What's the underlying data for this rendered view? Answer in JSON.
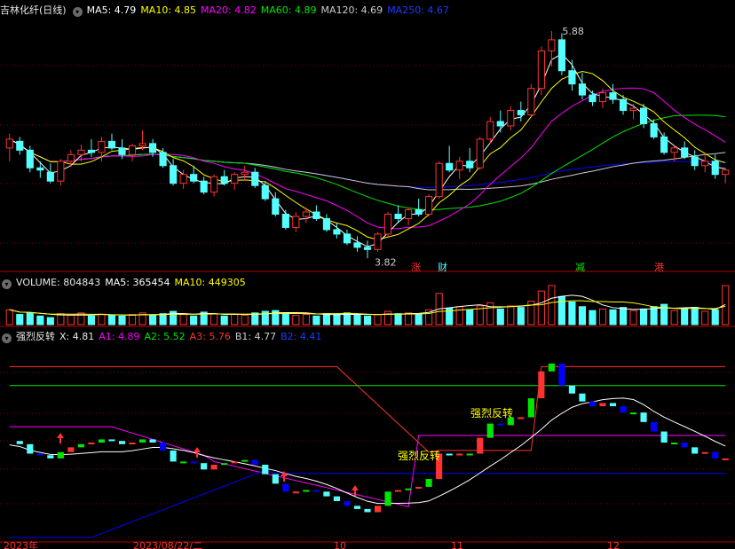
{
  "main_legend": {
    "title": "吉林化纤(日线)",
    "ma5": "MA5: 4.79",
    "ma10": "MA10: 4.85",
    "ma20": "MA20: 4.82",
    "ma60": "MA60: 4.89",
    "ma120": "MA120: 4.69",
    "ma250": "MA250: 4.67"
  },
  "volume_legend": {
    "volume": "VOLUME: 804843",
    "ma5": "MA5: 365454",
    "ma10": "MA10: 449305"
  },
  "indicator_legend": {
    "name": "强烈反转",
    "x": "X: 4.81",
    "a1": "A1: 4.89",
    "a2": "A2: 5.52",
    "a3": "A3: 5.76",
    "b1": "B1: 4.77",
    "b2": "B2: 4.41"
  },
  "colors": {
    "up": "#ff3232",
    "down": "#54ffff",
    "ma5": "#ffffff",
    "ma10": "#ffff00",
    "ma20": "#ff00ff",
    "ma60": "#00e600",
    "ma120": "#cccccc",
    "ma250": "#0000ff",
    "grid": "#7f0000",
    "axis": "#b00000"
  },
  "chart_data": {
    "type": "candlestick",
    "high_label": "5.88",
    "low_label": "3.82",
    "event_tags": [
      "涨",
      "财",
      "减",
      "港"
    ],
    "signal_labels": [
      "强烈反转",
      "强烈反转"
    ],
    "date_labels": [
      "2023年",
      "2023/08/22/二",
      "10",
      "11",
      "12"
    ],
    "ohlc": [
      [
        4.82,
        4.95,
        4.7,
        4.9
      ],
      [
        4.88,
        4.92,
        4.76,
        4.8
      ],
      [
        4.8,
        4.84,
        4.6,
        4.64
      ],
      [
        4.64,
        4.7,
        4.55,
        4.62
      ],
      [
        4.6,
        4.68,
        4.5,
        4.52
      ],
      [
        4.52,
        4.72,
        4.48,
        4.7
      ],
      [
        4.7,
        4.8,
        4.65,
        4.76
      ],
      [
        4.76,
        4.85,
        4.7,
        4.8
      ],
      [
        4.8,
        4.9,
        4.74,
        4.78
      ],
      [
        4.78,
        4.92,
        4.7,
        4.88
      ],
      [
        4.88,
        4.95,
        4.8,
        4.82
      ],
      [
        4.82,
        4.9,
        4.72,
        4.76
      ],
      [
        4.76,
        4.86,
        4.7,
        4.84
      ],
      [
        4.84,
        4.98,
        4.8,
        4.86
      ],
      [
        4.86,
        4.9,
        4.74,
        4.78
      ],
      [
        4.78,
        4.82,
        4.64,
        4.66
      ],
      [
        4.66,
        4.72,
        4.48,
        4.5
      ],
      [
        4.5,
        4.62,
        4.45,
        4.58
      ],
      [
        4.58,
        4.66,
        4.5,
        4.52
      ],
      [
        4.52,
        4.56,
        4.4,
        4.42
      ],
      [
        4.42,
        4.58,
        4.38,
        4.56
      ],
      [
        4.56,
        4.62,
        4.48,
        4.5
      ],
      [
        4.5,
        4.6,
        4.44,
        4.58
      ],
      [
        4.58,
        4.66,
        4.52,
        4.6
      ],
      [
        4.6,
        4.64,
        4.46,
        4.48
      ],
      [
        4.48,
        4.52,
        4.34,
        4.36
      ],
      [
        4.36,
        4.42,
        4.2,
        4.22
      ],
      [
        4.22,
        4.26,
        4.08,
        4.1
      ],
      [
        4.1,
        4.24,
        4.06,
        4.2
      ],
      [
        4.2,
        4.28,
        4.14,
        4.24
      ],
      [
        4.24,
        4.3,
        4.16,
        4.18
      ],
      [
        4.18,
        4.22,
        4.06,
        4.08
      ],
      [
        4.08,
        4.14,
        4.0,
        4.04
      ],
      [
        4.04,
        4.08,
        3.94,
        3.96
      ],
      [
        3.96,
        4.02,
        3.88,
        3.92
      ],
      [
        3.92,
        3.98,
        3.82,
        3.9
      ],
      [
        3.9,
        4.06,
        3.88,
        4.04
      ],
      [
        4.04,
        4.24,
        4.02,
        4.22
      ],
      [
        4.22,
        4.3,
        4.14,
        4.18
      ],
      [
        4.18,
        4.28,
        4.12,
        4.26
      ],
      [
        4.26,
        4.36,
        4.2,
        4.22
      ],
      [
        4.22,
        4.4,
        4.2,
        4.38
      ],
      [
        4.38,
        4.7,
        4.36,
        4.68
      ],
      [
        4.68,
        4.84,
        4.6,
        4.62
      ],
      [
        4.62,
        4.74,
        4.54,
        4.7
      ],
      [
        4.7,
        4.82,
        4.6,
        4.64
      ],
      [
        4.64,
        4.92,
        4.62,
        4.9
      ],
      [
        4.9,
        5.1,
        4.86,
        5.06
      ],
      [
        5.06,
        5.16,
        4.96,
        5.02
      ],
      [
        5.02,
        5.2,
        4.98,
        5.16
      ],
      [
        5.16,
        5.24,
        5.06,
        5.12
      ],
      [
        5.12,
        5.4,
        5.1,
        5.36
      ],
      [
        5.36,
        5.74,
        5.3,
        5.7
      ],
      [
        5.7,
        5.88,
        5.56,
        5.8
      ],
      [
        5.8,
        5.86,
        5.48,
        5.52
      ],
      [
        5.52,
        5.62,
        5.34,
        5.4
      ],
      [
        5.4,
        5.5,
        5.26,
        5.3
      ],
      [
        5.3,
        5.34,
        5.2,
        5.24
      ],
      [
        5.24,
        5.36,
        5.18,
        5.32
      ],
      [
        5.32,
        5.4,
        5.22,
        5.26
      ],
      [
        5.26,
        5.3,
        5.12,
        5.16
      ],
      [
        5.16,
        5.22,
        5.08,
        5.18
      ],
      [
        5.18,
        5.22,
        5.0,
        5.04
      ],
      [
        5.04,
        5.08,
        4.9,
        4.92
      ],
      [
        4.92,
        4.96,
        4.76,
        4.78
      ],
      [
        4.78,
        4.84,
        4.7,
        4.82
      ],
      [
        4.82,
        4.88,
        4.72,
        4.74
      ],
      [
        4.74,
        4.8,
        4.62,
        4.66
      ],
      [
        4.66,
        4.78,
        4.6,
        4.7
      ],
      [
        4.7,
        4.76,
        4.54,
        4.58
      ],
      [
        4.58,
        4.64,
        4.5,
        4.62
      ]
    ],
    "volume": [
      38,
      26,
      30,
      22,
      18,
      28,
      24,
      30,
      22,
      27,
      24,
      22,
      26,
      30,
      24,
      28,
      34,
      26,
      22,
      32,
      28,
      22,
      26,
      24,
      30,
      34,
      36,
      30,
      24,
      26,
      22,
      28,
      26,
      30,
      24,
      22,
      26,
      34,
      28,
      30,
      26,
      38,
      80,
      42,
      46,
      38,
      48,
      56,
      40,
      48,
      44,
      60,
      86,
      100,
      72,
      58,
      46,
      36,
      40,
      38,
      44,
      36,
      40,
      46,
      52,
      36,
      42,
      44,
      34,
      38,
      100
    ],
    "indicator": [
      4.82,
      4.78,
      4.66,
      4.64,
      4.6,
      4.68,
      4.74,
      4.78,
      4.8,
      4.84,
      4.82,
      4.78,
      4.8,
      4.84,
      4.8,
      4.7,
      4.56,
      4.56,
      4.54,
      4.46,
      4.52,
      4.54,
      4.56,
      4.58,
      4.52,
      4.4,
      4.28,
      4.18,
      4.18,
      4.2,
      4.18,
      4.12,
      4.06,
      4.0,
      3.96,
      3.92,
      4.0,
      4.18,
      4.2,
      4.22,
      4.24,
      4.34,
      4.66,
      4.64,
      4.66,
      4.66,
      4.86,
      5.04,
      5.02,
      5.12,
      5.12,
      5.36,
      5.7,
      5.8,
      5.52,
      5.42,
      5.32,
      5.26,
      5.3,
      5.26,
      5.18,
      5.18,
      5.06,
      4.94,
      4.8,
      4.8,
      4.74,
      4.66,
      4.68,
      4.6,
      4.6
    ]
  }
}
